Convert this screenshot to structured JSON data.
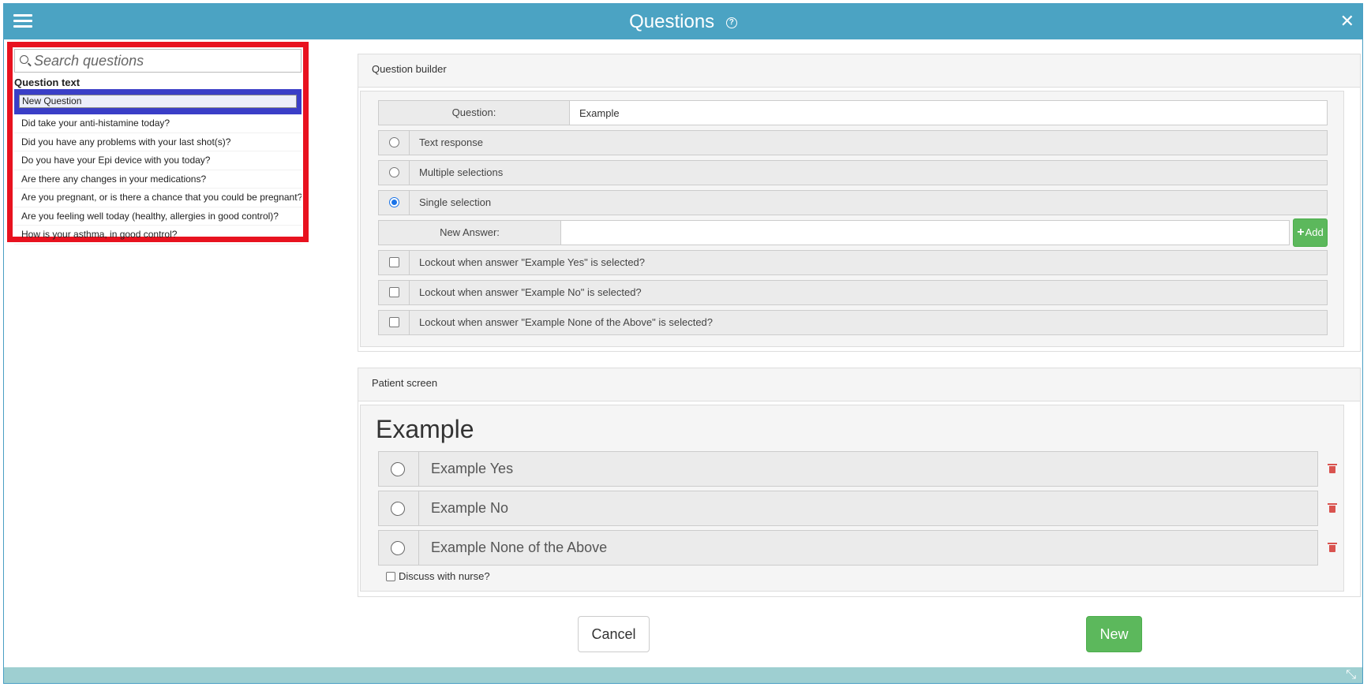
{
  "window": {
    "title": "Questions",
    "help_glyph": "?",
    "close_glyph": "✕",
    "resize_glyph": "⤡"
  },
  "search": {
    "placeholder": "Search questions",
    "value": ""
  },
  "question_list": {
    "header": "Question text",
    "items": [
      "New Question",
      "Did take your anti-histamine today?",
      "Did you have any problems with your last shot(s)?",
      "Do you have your Epi device with you today?",
      "Are there any changes in your medications?",
      "Are you pregnant, or is there a chance that you could be pregnant?",
      "Are you feeling well today (healthy, allergies in good control)?",
      "How is your asthma, in good control?"
    ],
    "selected_index": 0
  },
  "builder": {
    "heading": "Question builder",
    "question_label": "Question:",
    "question_value": "Example",
    "types": [
      {
        "label": "Text response",
        "checked": false
      },
      {
        "label": "Multiple selections",
        "checked": false
      },
      {
        "label": "Single selection",
        "checked": true
      }
    ],
    "new_answer_label": "New Answer:",
    "new_answer_value": "",
    "add_label": "Add",
    "lockouts": [
      "Lockout when answer \"Example Yes\" is selected?",
      "Lockout when answer \"Example No\" is selected?",
      "Lockout when answer \"Example None of the Above\" is selected?"
    ]
  },
  "patient_screen": {
    "heading": "Patient screen",
    "question": "Example",
    "answers": [
      "Example Yes",
      "Example No",
      "Example None of the Above"
    ],
    "discuss_label": "Discuss with nurse?"
  },
  "actions": {
    "cancel_label": "Cancel",
    "new_label": "New"
  },
  "colors": {
    "titlebar": "#4ba3c3",
    "highlight_border": "#e8121f",
    "selected_row": "#3a3ec7",
    "success": "#5cb85c",
    "danger": "#d9534f"
  }
}
